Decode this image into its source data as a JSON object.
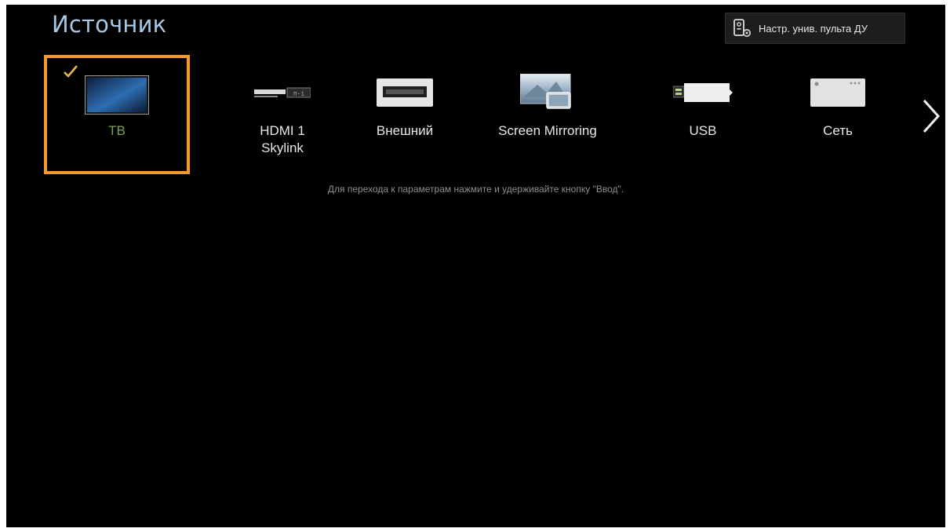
{
  "header": {
    "title": "Источник",
    "remote_button_label": "Настр. унив. пульта ДУ"
  },
  "sources": [
    {
      "label": "ТВ",
      "selected": true,
      "icon": "tv-icon"
    },
    {
      "label_line1": "HDMI 1",
      "label_line2": "Skylink",
      "icon": "hdmi-icon"
    },
    {
      "label": "Внешний",
      "icon": "external-icon"
    },
    {
      "label": "Screen Mirroring",
      "icon": "screen-mirroring-icon"
    },
    {
      "label": "USB",
      "icon": "usb-icon"
    },
    {
      "label": "Сеть",
      "icon": "network-icon"
    }
  ],
  "hint": "Для перехода к параметрам нажмите и удерживайте кнопку \"Ввод\".",
  "colors": {
    "background": "#000000",
    "title": "#a9c8e4",
    "selection_border": "#f29a2e",
    "selected_label": "#7ea05a",
    "checkmark": "#e8b84a"
  }
}
